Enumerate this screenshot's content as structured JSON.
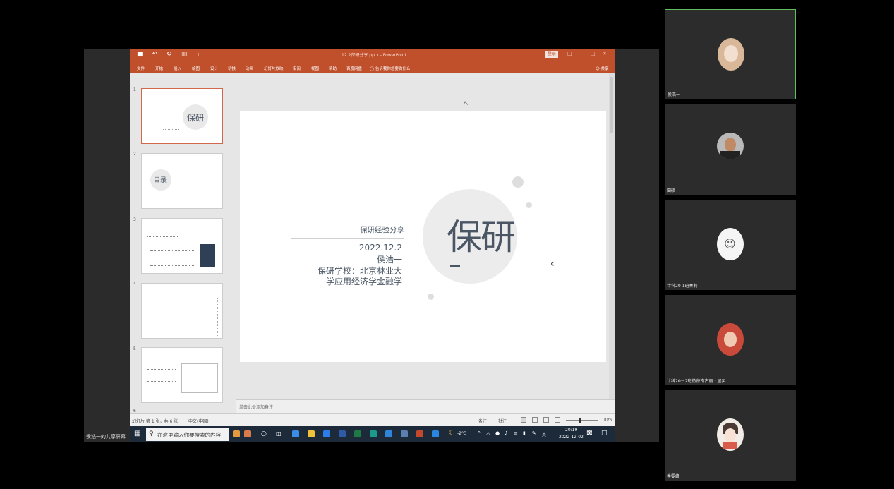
{
  "ppt": {
    "doc_title": "12.2保研分享.pptx - PowerPoint",
    "login_label": "登录",
    "share_label": "共享",
    "tell_me": "告诉我你想要做什么",
    "menu": [
      "文件",
      "开始",
      "插入",
      "绘图",
      "设计",
      "切换",
      "动画",
      "幻灯片放映",
      "审阅",
      "视图",
      "帮助",
      "百度网盘"
    ],
    "thumb_numbers": [
      "1",
      "2",
      "3",
      "4",
      "5",
      "6"
    ],
    "thumb1_word": "保研",
    "thumb2_word": "目录",
    "notes_placeholder": "单击此处添加备注",
    "status_slide": "幻灯片 第 1 张，共 6 张",
    "status_lang": "中文(中国)",
    "status_notes": "备注",
    "status_comments": "批注",
    "zoom": "89%"
  },
  "slide": {
    "title": "保研经验分享",
    "date": "2022.12.2",
    "name": "侯浩一",
    "school_line1": "保研学校：北京林业大",
    "school_line2": "学应用经济学金融学",
    "big_text": "保研"
  },
  "taskbar": {
    "search_placeholder": "在这里输入你要搜索的内容",
    "weather": "-2℃",
    "ime": "英",
    "time": "20:19",
    "date": "2022-12-02"
  },
  "meeting": {
    "sharer_label": "侯浩一的共享屏幕",
    "participants": [
      {
        "name": "侯浩一"
      },
      {
        "name": "田硕"
      },
      {
        "name": "计科20-1班寨莉"
      },
      {
        "name": "计科20－2班热依南古丽・居买"
      },
      {
        "name": "季雯峰"
      }
    ]
  }
}
